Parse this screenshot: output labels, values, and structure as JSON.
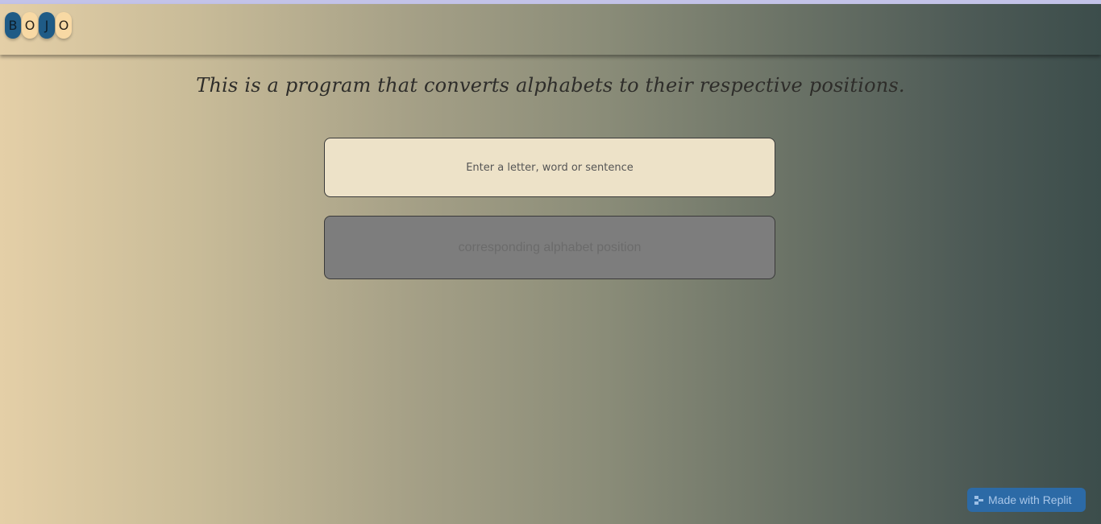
{
  "header": {
    "logo_letters": [
      "B",
      "O",
      "J",
      "O"
    ]
  },
  "main": {
    "tagline": "This is a program that converts alphabets to their respective positions.",
    "input": {
      "placeholder": "Enter a letter, word or sentence",
      "value": ""
    },
    "output": {
      "placeholder": "corresponding alphabet position",
      "value": ""
    }
  },
  "badge": {
    "label": "Made with Replit",
    "icon": "replit-icon"
  },
  "colors": {
    "logo_dark": "#1f5b86",
    "logo_light": "#f8d9a4",
    "badge_bg": "#2c6aa6"
  }
}
